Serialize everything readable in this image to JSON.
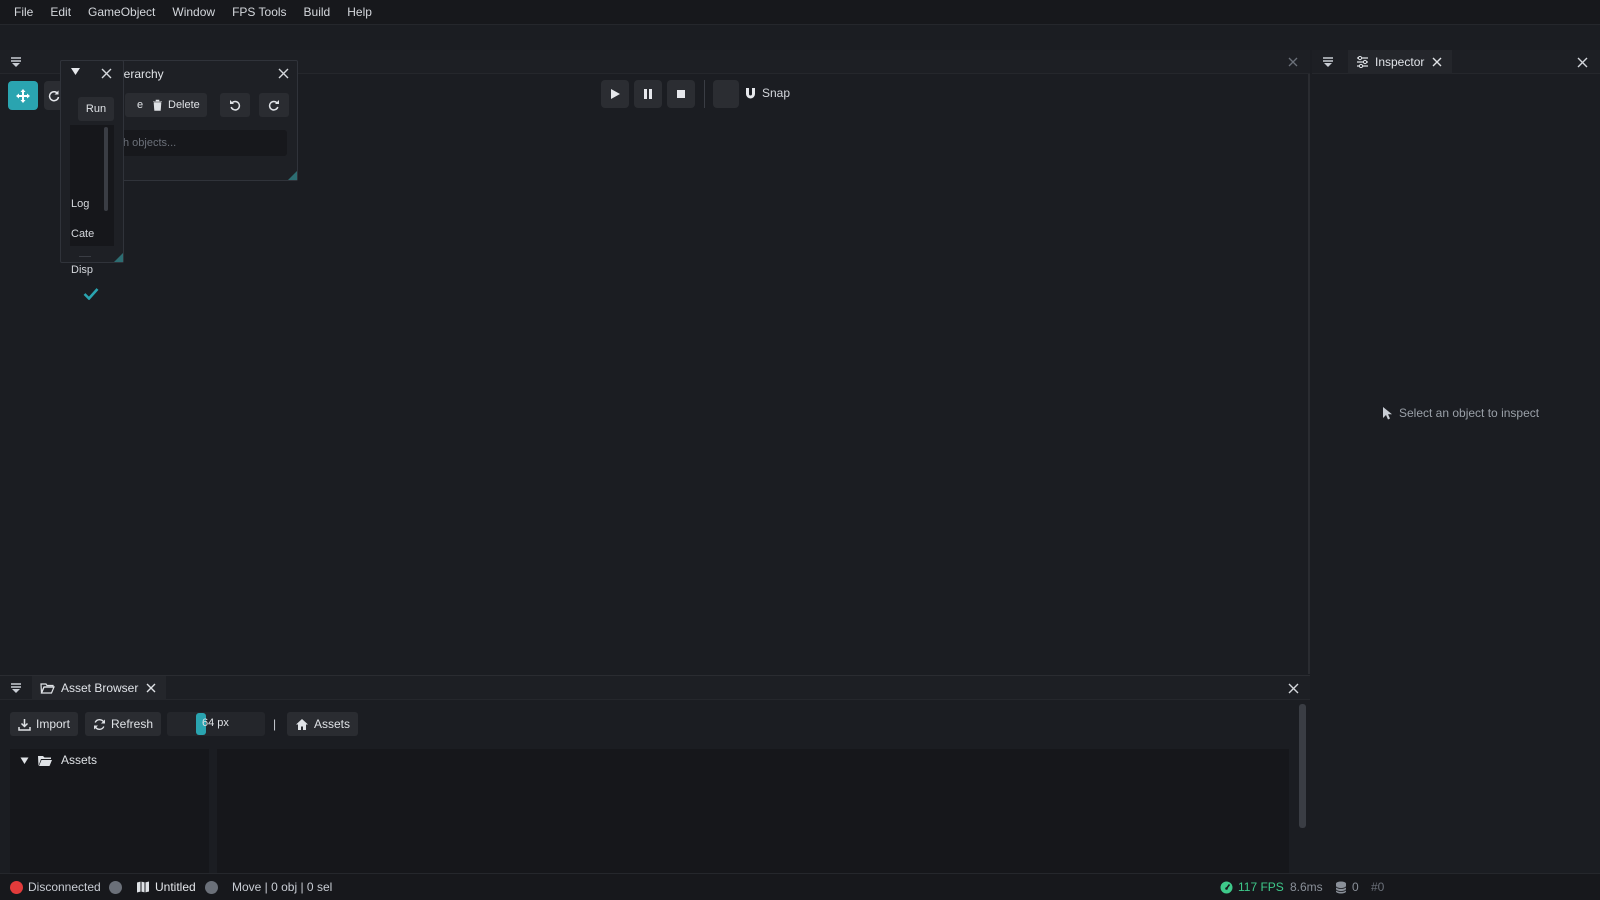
{
  "menu": [
    "File",
    "Edit",
    "GameObject",
    "Window",
    "FPS Tools",
    "Build",
    "Help"
  ],
  "scene": {
    "controls": [
      "play-icon",
      "pause-icon",
      "stop-icon"
    ],
    "snap_label": "Snap"
  },
  "hierarchy": {
    "title_visible": "ierarchy",
    "buttons": {
      "run": "Run",
      "create_fragment": "e",
      "delete": "Delete"
    },
    "search_placeholder": "h objects..."
  },
  "console": {
    "items": [
      "Log",
      "Cate",
      "Disp"
    ]
  },
  "inspector": {
    "tab_label": "Inspector",
    "empty_message": "Select an object to inspect"
  },
  "asset_browser": {
    "tab_label": "Asset Browser",
    "import_label": "Import",
    "refresh_label": "Refresh",
    "size_label": "64 px",
    "size_fraction": 0.3,
    "separator": "|",
    "breadcrumb_root": "Assets",
    "tree_root": "Assets"
  },
  "status": {
    "connection": "Disconnected",
    "scene_name": "Untitled",
    "mode_text": "Move | 0 obj | 0 sel",
    "fps": "117 FPS",
    "frame_time": "8.6ms",
    "db_count": "0",
    "frame_id": "#0"
  },
  "colors": {
    "accent": "#2aa4b0",
    "error": "#e23b3b",
    "fps_good": "#3ec98a"
  }
}
